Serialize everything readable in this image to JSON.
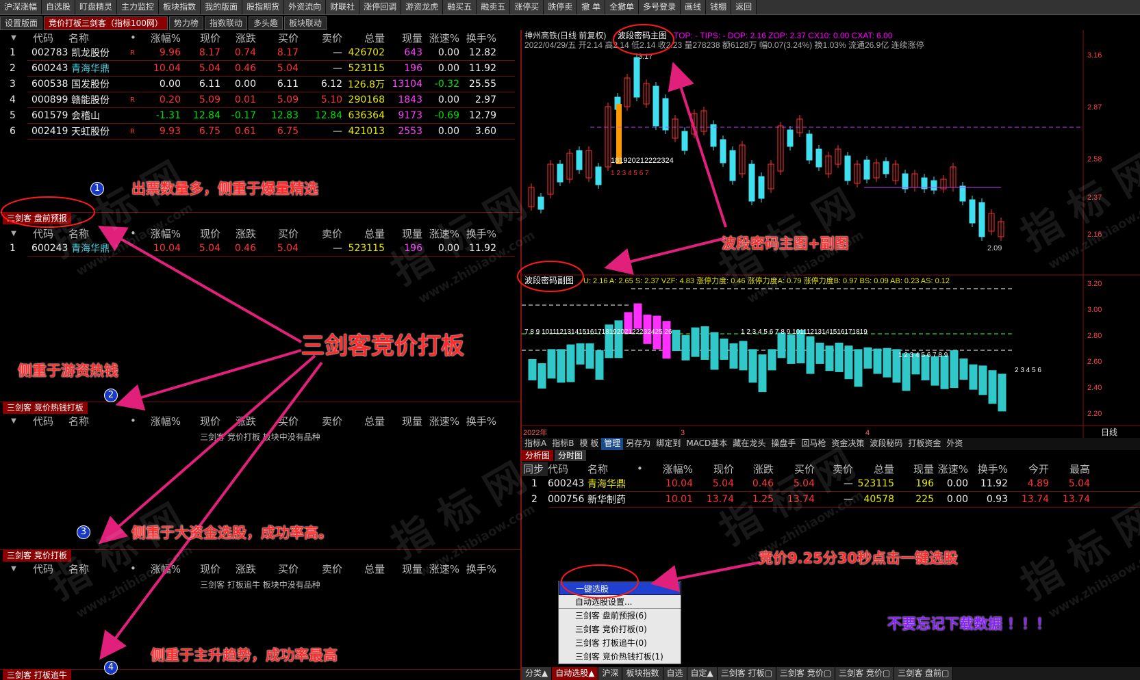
{
  "toolbar": [
    "沪深涨幅",
    "自选股",
    "盯盘精灵",
    "主力监控",
    "板块指数",
    "我的版面",
    "股指期货",
    "外资流向",
    "财联社",
    "涨停回调",
    "游资龙虎",
    "融买五",
    "融卖五",
    "涨停买",
    "跌停卖",
    "撤 单",
    "全撤单",
    "多号登录",
    "画线",
    "钱棚",
    "返回"
  ],
  "subtabs": [
    "设置版面",
    "竞价打板三剑客（指标100网）",
    "势力榜",
    "指数联动",
    "多头趣",
    "板块联动"
  ],
  "columns": [
    "代码",
    "名称",
    "•",
    "涨幅%",
    "现价",
    "涨跌",
    "买价",
    "卖价",
    "总量",
    "现量",
    "涨速%",
    "换手%"
  ],
  "table1": [
    {
      "n": "1",
      "code": "002783",
      "name": "凯龙股份",
      "f": "R",
      "pct": "9.96",
      "price": "8.17",
      "chg": "0.74",
      "bid": "8.17",
      "ask": "—",
      "vol": "426702",
      "cur": "643",
      "spd": "0.00",
      "turn": "12.82"
    },
    {
      "n": "2",
      "code": "600243",
      "name": "青海华鼎",
      "f": "",
      "pct": "10.04",
      "price": "5.04",
      "chg": "0.46",
      "bid": "5.04",
      "ask": "—",
      "vol": "523115",
      "cur": "196",
      "spd": "0.00",
      "turn": "11.92"
    },
    {
      "n": "3",
      "code": "600538",
      "name": "国发股份",
      "f": "",
      "pct": "0.00",
      "price": "6.11",
      "chg": "0.00",
      "bid": "6.11",
      "ask": "6.12",
      "vol": "126.8万",
      "cur": "13104",
      "spd": "-0.32",
      "turn": "25.55"
    },
    {
      "n": "4",
      "code": "000899",
      "name": "赣能股份",
      "f": "R",
      "pct": "0.20",
      "price": "5.09",
      "chg": "0.01",
      "bid": "5.09",
      "ask": "5.10",
      "vol": "290168",
      "cur": "1843",
      "spd": "0.00",
      "turn": "2.97"
    },
    {
      "n": "5",
      "code": "601579",
      "name": "会稽山",
      "f": "",
      "pct": "-1.31",
      "price": "12.84",
      "chg": "-0.17",
      "bid": "12.83",
      "ask": "12.84",
      "vol": "636364",
      "cur": "9173",
      "spd": "-0.69",
      "turn": "12.79"
    },
    {
      "n": "6",
      "code": "002419",
      "name": "天虹股份",
      "f": "R",
      "pct": "9.93",
      "price": "6.75",
      "chg": "0.61",
      "bid": "6.75",
      "ask": "—",
      "vol": "421013",
      "cur": "2553",
      "spd": "0.00",
      "turn": "3.60"
    }
  ],
  "sec1": "三剑客 盘前预报",
  "table2": [
    {
      "n": "1",
      "code": "600243",
      "name": "青海华鼎",
      "pct": "10.04",
      "price": "5.04",
      "chg": "0.46",
      "bid": "5.04",
      "ask": "—",
      "vol": "523115",
      "cur": "196",
      "spd": "0.00",
      "turn": "11.92"
    }
  ],
  "sec2": "三剑客 竞价热钱打板",
  "sec3": "三剑客 竞价打板",
  "sec4": "三剑客 打板追牛",
  "empty2": "三剑客 竞价打板 板块中没有品种",
  "empty3": "三剑客 打板追牛 板块中没有品种",
  "notes": {
    "n1": "出票数量多，侧重于爆量精选",
    "main": "三剑客竞价打板",
    "n2": "侧重于游资热钱",
    "n3": "侧重于大资金选股，成功率高。",
    "n4": "侧重于主升趋势，成功率最高",
    "chart": "波段密码主图+副图",
    "bid": "竞价9.25分30秒点击一键选股",
    "dl": "不要忘记下载数据 ！！！"
  },
  "circles": [
    "1",
    "2",
    "3",
    "4"
  ],
  "chart": {
    "title": "神州高铁(日线 前复权)",
    "ind_main": "波段密码主图",
    "top_info": "TOP: - TIPS: - DOP: 2.16 ZOP: 2.37 CX10: 0.00 CXAT: 6.00",
    "date_line": "2022/04/29/五 开2.14 高2.14 低2.14 收2.23 量278238 额6128万 幅0.07(3.24%) 换1.03% 流通26.9亿 连续涨停",
    "hi": "3.17",
    "lo": "2.09",
    "seq": "181920212222324",
    "seq2": "1 2 3 4 5 6 7",
    "axis": [
      "3.16",
      "2.87",
      "2.58",
      "2.37",
      "2.16"
    ],
    "sub_title": "波段密码副图",
    "sub_info": "U: 2.16 A: 2.65 S: 2.37 VZF: 4.83 涨停力度: 0.46 涨停力度A: 0.79 涨停力度B: 0.97 BS: 0.09 AB: 0.23 AS: 0.12",
    "sub_axis": [
      "3.20",
      "3.00",
      "2.80",
      "2.60",
      "2.40",
      "2.20"
    ],
    "sub_seq": "7 8 9 10111213141516171819202122232425 26",
    "sub_seq2": "1 2 3 4 5 6 7 8 9 10111213141516171819",
    "sub_seq3": "1 2 3 4 5 6 7 8 9",
    "sub_seq4": "2 3 4 5 6",
    "xlbl": [
      "2022年",
      "3",
      "4"
    ],
    "period": "日线"
  },
  "indtabs": [
    "指标A",
    "指标B",
    "模 板",
    "管理",
    "另存为",
    "绑定到",
    "MACD基本",
    "藏在龙头",
    "操盘手",
    "回马枪",
    "资金决策",
    "波段秘码",
    "打板资金",
    "外资"
  ],
  "lowtabs": [
    "分析图",
    "分时图"
  ],
  "lowcols": [
    "同步",
    "代码",
    "名称",
    "•",
    "涨幅%",
    "现价",
    "涨跌",
    "买价",
    "卖价",
    "总量",
    "现量",
    "涨速%",
    "换手%",
    "今开",
    "最高"
  ],
  "lowrows": [
    {
      "n": "1",
      "code": "600243",
      "name": "青海华鼎",
      "pct": "10.04",
      "price": "5.04",
      "chg": "0.46",
      "bid": "5.04",
      "ask": "—",
      "vol": "523115",
      "cur": "196",
      "spd": "0.00",
      "turn": "11.92",
      "open": "4.89",
      "high": "5.04"
    },
    {
      "n": "2",
      "code": "000756",
      "name": "新华制药",
      "pct": "10.01",
      "price": "13.74",
      "chg": "1.25",
      "bid": "13.74",
      "ask": "—",
      "vol": "40578",
      "cur": "225",
      "spd": "0.00",
      "turn": "0.93",
      "open": "13.74",
      "high": "13.74"
    }
  ],
  "menu": [
    "一键选股",
    "自动选股设置...",
    "三剑客 盘前预报(6)",
    "三剑客 竞价打板(0)",
    "三剑客 打板追牛(0)",
    "三剑客 竞价热钱打板(1)"
  ],
  "btmtabs": [
    "分类▲",
    "自动选股▲",
    "沪深",
    "板块指数",
    "自选",
    "自定▲",
    "三剑客 打板▢",
    "三剑客 竞价▢",
    "三剑客 竞价▢",
    "三剑客 盘前▢"
  ],
  "watermark": [
    "指 标 网",
    "www.zhibiaow.com"
  ]
}
